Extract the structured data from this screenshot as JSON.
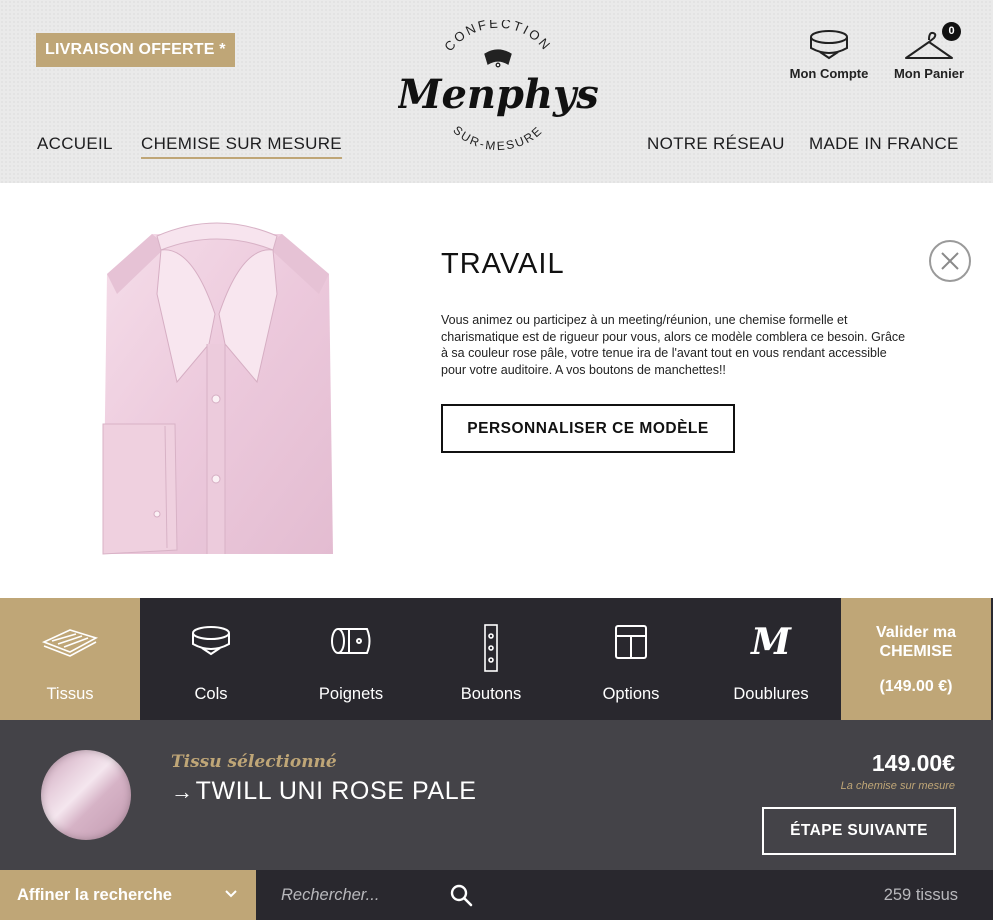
{
  "header": {
    "promo": "LIVRAISON OFFERTE *",
    "logo": {
      "top_text": "CONFECTION",
      "name": "Menphys",
      "bottom_text": "SUR-MESURE"
    },
    "account_label": "Mon Compte",
    "cart_label": "Mon Panier",
    "cart_count": "0",
    "nav": [
      {
        "label": "ACCUEIL"
      },
      {
        "label": "CHEMISE SUR MESURE",
        "active": true
      },
      {
        "label": "NOTRE RÉSEAU"
      },
      {
        "label": "MADE IN FRANCE"
      }
    ]
  },
  "product": {
    "title": "TRAVAIL",
    "description": "Vous animez ou participez à un meeting/réunion, une chemise formelle et charismatique est de rigueur pour vous, alors ce modèle comblera ce besoin. Grâce à sa couleur rose pâle, votre tenue ira de l'avant tout en vous rendant accessible pour votre auditoire. A vos boutons de manchettes!!",
    "customize_button": "PERSONNALISER CE MODÈLE",
    "shirt_color": "#f0d4e2"
  },
  "steps": [
    {
      "label": "Tissus",
      "icon": "fabric-icon",
      "active": true
    },
    {
      "label": "Cols",
      "icon": "collar-icon"
    },
    {
      "label": "Poignets",
      "icon": "cuff-icon"
    },
    {
      "label": "Boutons",
      "icon": "buttons-icon"
    },
    {
      "label": "Options",
      "icon": "options-icon"
    },
    {
      "label": "Doublures",
      "icon": "lining-icon"
    }
  ],
  "validate": {
    "line1": "Valider ma",
    "line2": "CHEMISE",
    "price": "(149.00 €)"
  },
  "selected_fabric": {
    "label": "Tissu sélectionné",
    "name": "TWILL UNI ROSE PALE",
    "price": "149.00€",
    "price_sub": "La chemise sur mesure",
    "next_button": "ÉTAPE SUIVANTE"
  },
  "search": {
    "filter_label": "Affiner la recherche",
    "placeholder": "Rechercher...",
    "count": "259 tissus"
  },
  "colors": {
    "gold": "#bfa677",
    "dark": "#29282e",
    "panel": "#444348"
  }
}
